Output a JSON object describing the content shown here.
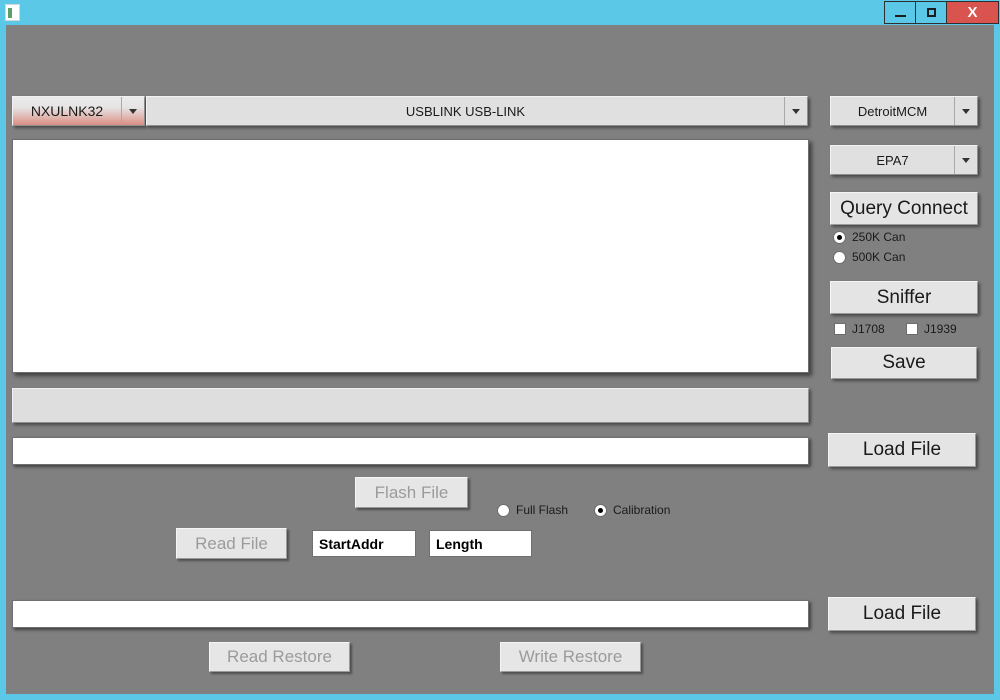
{
  "window": {
    "icon": "app-icon",
    "title": "",
    "titlebar_color": "#5BC8E8",
    "body_color": "#808080",
    "controls": {
      "minimize": "–",
      "maximize": "□",
      "close": "X"
    }
  },
  "toolbar": {
    "adapter_combo": {
      "value": "NXULNK32",
      "accent": "#d98d83"
    },
    "device_combo": {
      "value": "USBLINK USB-LINK"
    }
  },
  "right_panel": {
    "vehicle_combo": {
      "value": "DetroitMCM"
    },
    "standard_combo": {
      "value": "EPA7"
    },
    "query_connect_label": "Query Connect",
    "baud_options": [
      {
        "label": "250K Can",
        "selected": true
      },
      {
        "label": "500K Can",
        "selected": false
      }
    ],
    "sniffer_label": "Sniffer",
    "protocols": [
      {
        "label": "J1708",
        "checked": false
      },
      {
        "label": "J1939",
        "checked": false
      }
    ],
    "save_label": "Save",
    "load_file_label": "Load File",
    "load_file_restore_label": "Load File"
  },
  "main": {
    "log_area": {
      "value": ""
    },
    "progress_bar": {
      "value": ""
    },
    "file_path_field": {
      "value": ""
    },
    "restore_path_field": {
      "value": ""
    }
  },
  "flash_row": {
    "flash_file_label": "Flash File",
    "flash_file_enabled": false,
    "modes": [
      {
        "label": "Full Flash",
        "selected": false
      },
      {
        "label": "Calibration",
        "selected": true
      }
    ]
  },
  "read_row": {
    "read_file_label": "Read File",
    "read_file_enabled": false,
    "start_addr_field": {
      "value": "StartAddr"
    },
    "length_field": {
      "value": "Length"
    }
  },
  "restore_row": {
    "read_restore_label": "Read Restore",
    "read_restore_enabled": false,
    "write_restore_label": "Write Restore",
    "write_restore_enabled": false
  }
}
